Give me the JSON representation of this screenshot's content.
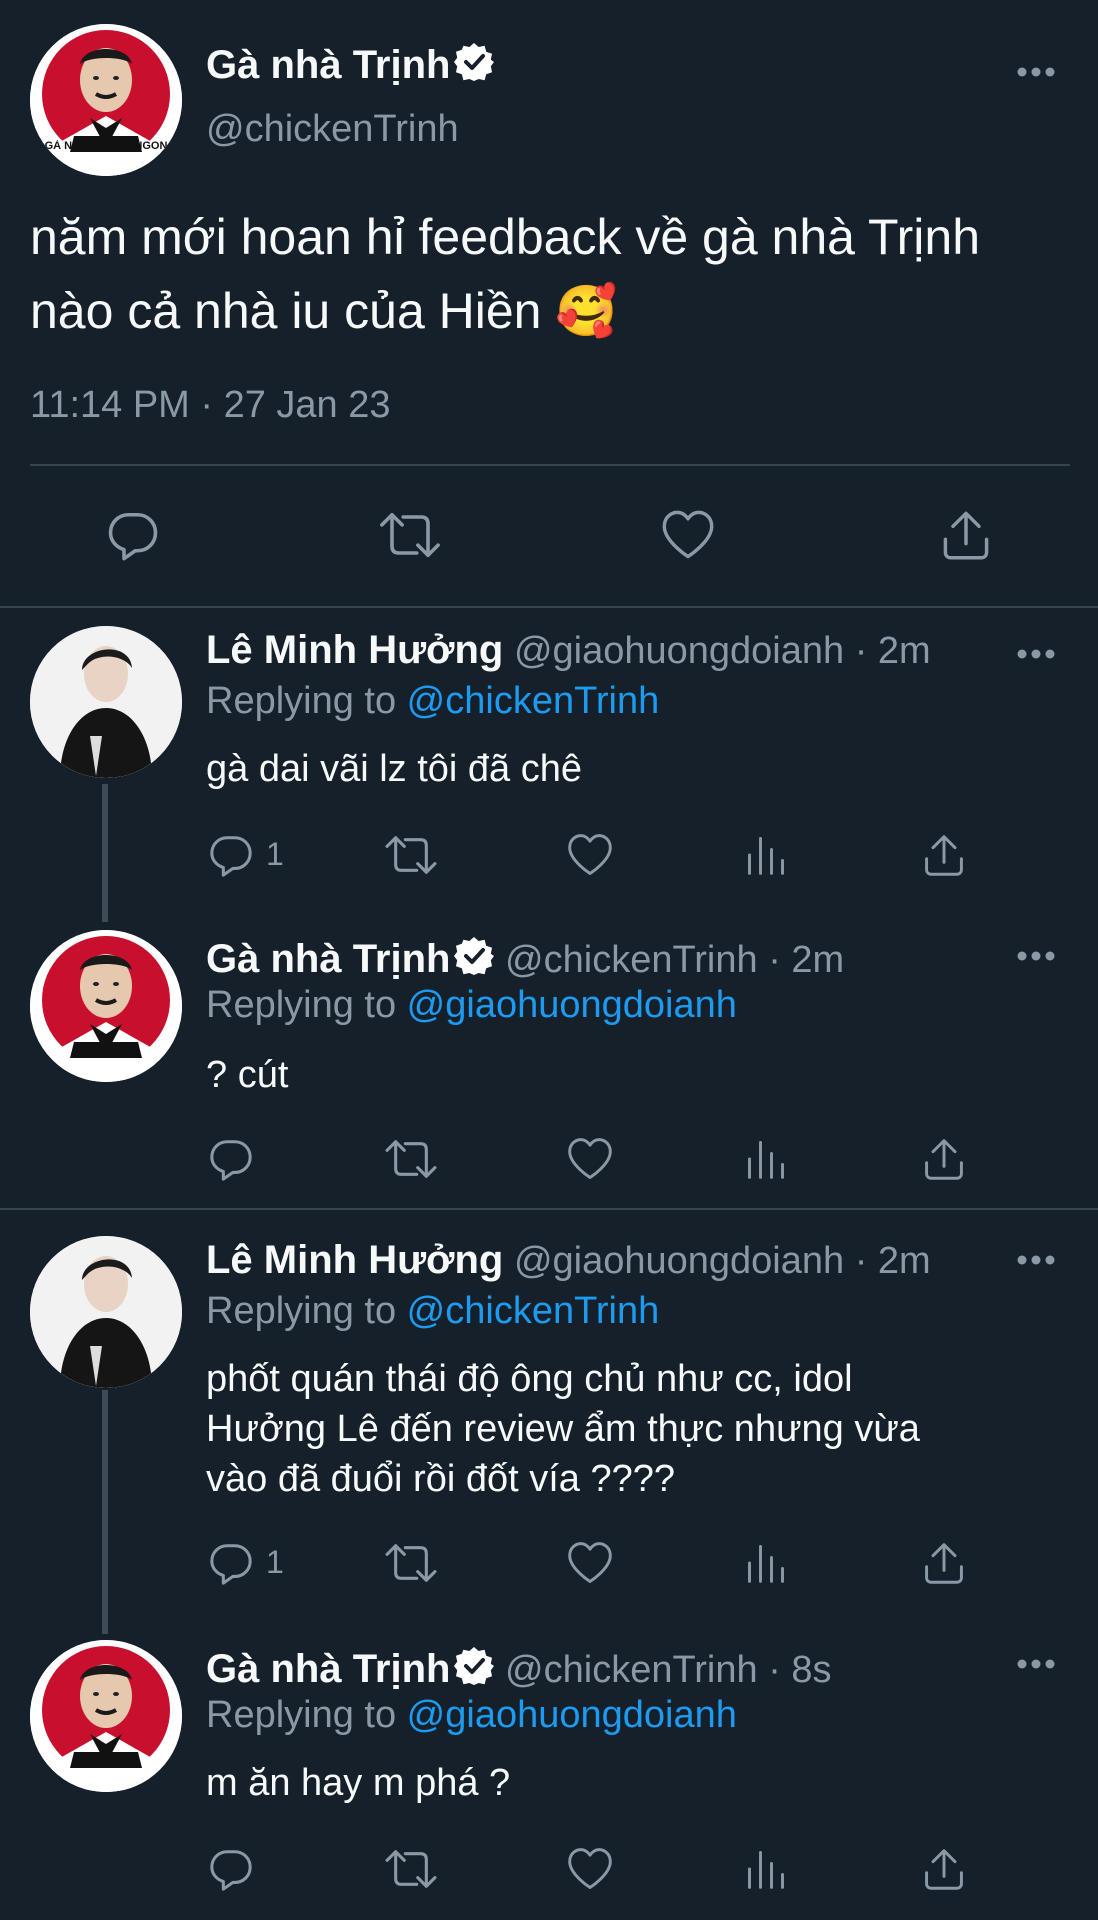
{
  "main_tweet": {
    "author": "Gà nhà Trịnh",
    "handle": "@chickenTrinh",
    "avatar_caption": "GÀ NHÀ TRỊNH : NGON",
    "text_line1": "năm mới hoan hỉ feedback về gà nhà Trịnh",
    "text_line2": "nào cả nhà iu của Hiền 🥰",
    "timestamp": "11:14 PM · 27 Jan 23"
  },
  "replies": [
    {
      "author": "Lê Minh Hưởng",
      "meta": "@giaohuongdoianh · 2m",
      "replying_prefix": "Replying to ",
      "replying_to": "@chickenTrinh",
      "text": "gà dai vãi lz tôi đã chê",
      "reply_count": "1"
    },
    {
      "author": "Gà nhà Trịnh",
      "meta": "@chickenTrinh · 2m",
      "replying_prefix": "Replying to ",
      "replying_to": "@giaohuongdoianh",
      "text": "? cút",
      "reply_count": ""
    },
    {
      "author": "Lê Minh Hưởng",
      "meta": "@giaohuongdoianh · 2m",
      "replying_prefix": "Replying to ",
      "replying_to": "@chickenTrinh",
      "text_lines": [
        "phốt quán thái độ ông chủ như cc, idol",
        "Hưởng Lê đến review ẩm thực nhưng vừa",
        "vào đã đuổi rồi đốt vía ????"
      ],
      "reply_count": "1"
    },
    {
      "author": "Gà nhà Trịnh",
      "meta": "@chickenTrinh · 8s",
      "replying_prefix": "Replying to ",
      "replying_to": "@giaohuongdoianh",
      "text": "m ăn hay m phá ?",
      "reply_count": ""
    }
  ],
  "colors": {
    "background": "#15202b",
    "text": "#f7f9f9",
    "muted": "#8b98a5",
    "link": "#1d9bf0"
  }
}
